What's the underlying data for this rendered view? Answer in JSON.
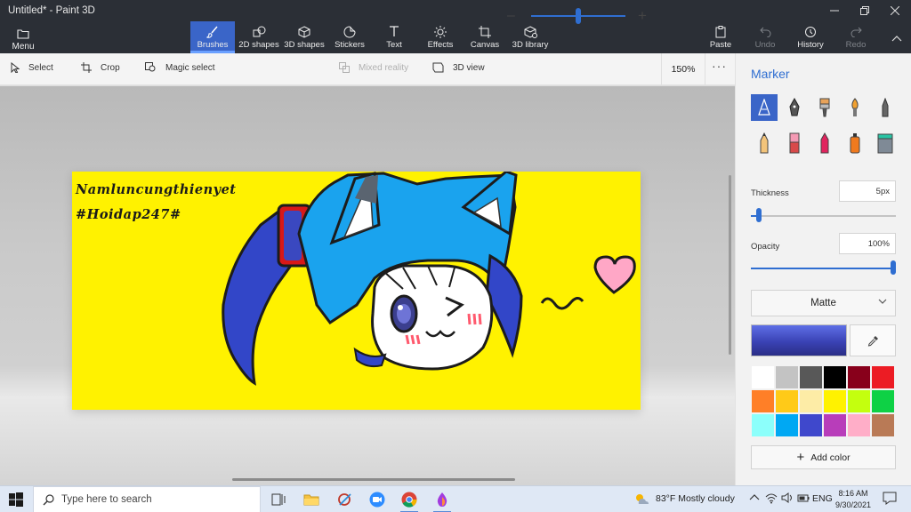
{
  "window": {
    "title": "Untitled* - Paint 3D",
    "controls": [
      "minimize",
      "maximize",
      "close"
    ]
  },
  "ribbon": {
    "menu_label": "Menu",
    "tools": [
      {
        "label": "Brushes",
        "icon": "brush-icon",
        "active": true
      },
      {
        "label": "2D shapes",
        "icon": "shapes-2d-icon"
      },
      {
        "label": "3D shapes",
        "icon": "cube-icon"
      },
      {
        "label": "Stickers",
        "icon": "sticker-icon"
      },
      {
        "label": "Text",
        "icon": "text-icon"
      },
      {
        "label": "Effects",
        "icon": "sun-icon"
      },
      {
        "label": "Canvas",
        "icon": "canvas-crop-icon"
      },
      {
        "label": "3D library",
        "icon": "library-icon"
      }
    ],
    "paste_label": "Paste",
    "undo_label": "Undo",
    "history_label": "History",
    "redo_label": "Redo"
  },
  "subbar": {
    "select_label": "Select",
    "crop_label": "Crop",
    "magic_select_label": "Magic select",
    "mixed_reality_label": "Mixed reality",
    "view3d_label": "3D view",
    "zoom_value_text": "150%",
    "zoom_level_fraction": 0.5,
    "more_label": "···"
  },
  "canvas": {
    "background_color": "#fff200",
    "text_line1": "Namluncungthienyet",
    "text_line2": "#Hoidap247#"
  },
  "panel": {
    "title": "Marker",
    "brushes_row1": [
      "marker-icon",
      "calligraphy-pen-icon",
      "oil-brush-icon",
      "watercolor-icon",
      "pixel-pen-icon"
    ],
    "brushes_row2": [
      "pencil-icon",
      "eraser-icon",
      "crayon-icon",
      "spray-can-icon",
      "fill-bucket-icon"
    ],
    "thickness_label": "Thickness",
    "thickness_value": "5px",
    "thickness_fraction": 0.04,
    "opacity_label": "Opacity",
    "opacity_value": "100%",
    "opacity_fraction": 1.0,
    "finish_value": "Matte",
    "current_color": "#3a42b4",
    "palette": [
      "#ffffff",
      "#c3c3c3",
      "#585858",
      "#000000",
      "#88001b",
      "#ec1c24",
      "#ff7f27",
      "#ffca18",
      "#fdeca6",
      "#fff200",
      "#c4ff0e",
      "#0ed145",
      "#8cfffb",
      "#00a8f3",
      "#3f48cc",
      "#b83dba",
      "#ffaec8",
      "#b97a56"
    ],
    "add_color_label": "Add color"
  },
  "taskbar": {
    "search_placeholder": "Type here to search",
    "weather": "83°F  Mostly cloudy",
    "language": "ENG",
    "time": "8:16 AM",
    "date": "9/30/2021"
  }
}
